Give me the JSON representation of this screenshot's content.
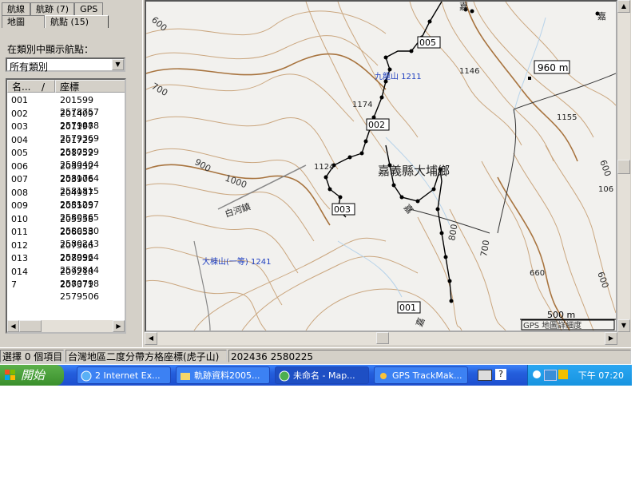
{
  "left_panel": {
    "tabs_row1": [
      "航線",
      "航跡 (7)",
      "GPS"
    ],
    "tabs_row2": [
      "地圖",
      "航點 (15)"
    ],
    "category_label": "在類別中顯示航點：",
    "category_value": "所有類別",
    "columns": [
      "名...",
      "座標"
    ],
    "sort_indicator": "/",
    "waypoints": [
      {
        "name": "001",
        "coord": "201599 2578757"
      },
      {
        "name": "002",
        "coord": "201409 2579888"
      },
      {
        "name": "003",
        "coord": "201197 2579369"
      },
      {
        "name": "004",
        "coord": "201729 2580399"
      },
      {
        "name": "005",
        "coord": "201752 2580404"
      },
      {
        "name": "006",
        "coord": "203332 2581764"
      },
      {
        "name": "007",
        "coord": "203906 2581815"
      },
      {
        "name": "008",
        "coord": "204937 2581297"
      },
      {
        "name": "009",
        "coord": "205505 2580365"
      },
      {
        "name": "010",
        "coord": "205558 2580330"
      },
      {
        "name": "011",
        "coord": "206658 2580243"
      },
      {
        "name": "012",
        "coord": "207566 2579964"
      },
      {
        "name": "013",
        "coord": "208052 2579844"
      },
      {
        "name": "014",
        "coord": "209218 2580798"
      },
      {
        "name": "7",
        "coord": "207371 2579506"
      }
    ]
  },
  "map": {
    "region_label": "嘉義縣大埔鄉",
    "road_label": "白河鎮",
    "altitude_box": "960 m",
    "scale_label": "500 m",
    "detail_label": "GPS 地圖詳細度",
    "waypoint_tags": [
      "005",
      "002",
      "003",
      "001"
    ],
    "peaks": [
      {
        "label": "九龍山 1211"
      },
      {
        "label": "大棟山(一等) 1241"
      }
    ],
    "spot_heights": [
      "1146",
      "1174",
      "1124",
      "1155",
      "660",
      "106"
    ],
    "contour_labels": [
      "600",
      "700",
      "900",
      "1000",
      "800",
      "700",
      "600",
      "600"
    ],
    "road_marks": [
      "嘉",
      "嘉",
      "嘉"
    ],
    "top_fragments": [
      "嘉"
    ]
  },
  "status": {
    "selected": "選擇 0 個項目",
    "projection": "台灣地區二度分帶方格座標(虎子山)",
    "cursor": "202436 2580225"
  },
  "taskbar": {
    "start": "開始",
    "tasks": [
      "2 Internet Ex...",
      "軌跡資料2005...",
      "未命名 - Map...",
      "GPS TrackMak..."
    ],
    "time": "下午 07:20"
  }
}
